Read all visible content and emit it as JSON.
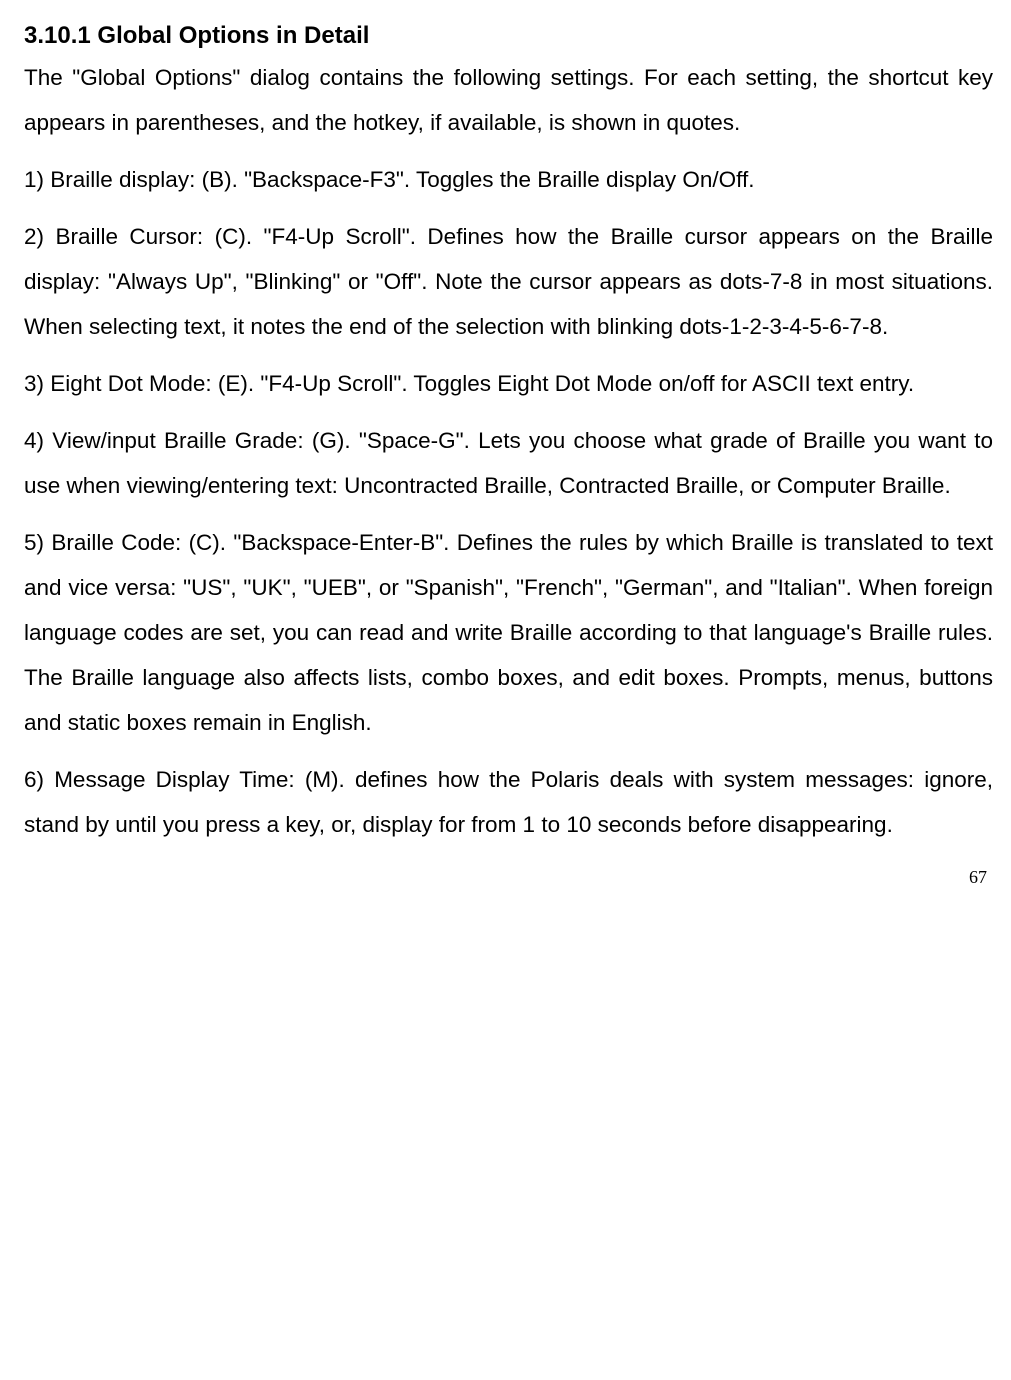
{
  "heading": "3.10.1 Global Options in Detail",
  "intro": "The \"Global Options\" dialog contains the following settings. For each setting, the shortcut key appears in parentheses, and the hotkey, if available, is shown in quotes.",
  "items": {
    "p1": "1) Braille display: (B). \"Backspace-F3\". Toggles the Braille display On/Off.",
    "p2": "2) Braille Cursor: (C). \"F4-Up Scroll\". Defines how the Braille cursor appears on the Braille display: \"Always Up\", \"Blinking\" or \"Off\". Note the cursor appears as dots-7-8 in most situations. When selecting text, it notes the end of the selection with blinking dots-1-2-3-4-5-6-7-8.",
    "p3": "3) Eight Dot Mode: (E). \"F4-Up Scroll\". Toggles Eight Dot Mode on/off for ASCII text entry.",
    "p4": "4) View/input Braille Grade: (G). \"Space-G\". Lets you choose what grade of Braille you want to use when viewing/entering text: Uncontracted Braille, Contracted Braille, or Computer Braille.",
    "p5": "5) Braille Code: (C). \"Backspace-Enter-B\". Defines the rules by which Braille is translated to text and vice versa: \"US\", \"UK\", \"UEB\", or \"Spanish\", \"French\", \"German\", and \"Italian\". When foreign language codes are set, you can read and write Braille according to that language's Braille rules. The Braille language also affects lists, combo boxes, and edit boxes. Prompts, menus, buttons and static boxes remain in English.",
    "p6": "6) Message Display Time: (M). defines how the Polaris deals with system messages: ignore, stand by until you press a key, or, display for from 1 to 10 seconds before disappearing."
  },
  "pageNumber": "67"
}
